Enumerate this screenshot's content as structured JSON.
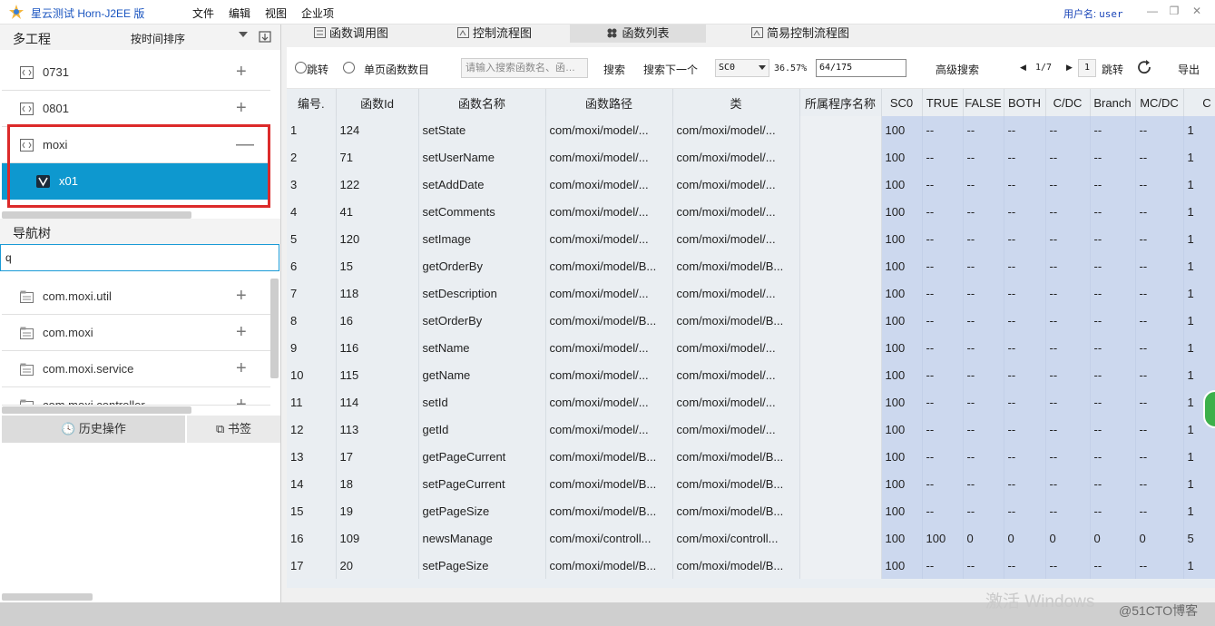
{
  "app": {
    "title": "星云测试 Horn-J2EE 版",
    "menus": [
      "文件",
      "编辑",
      "视图",
      "企业项"
    ],
    "user_label": "用户名:",
    "user_name": "user",
    "window_controls": [
      "minimize-icon",
      "restore-icon",
      "close-icon"
    ]
  },
  "projects": {
    "header": "多工程",
    "sort_label": "按时间排序",
    "items": [
      {
        "label": "0731",
        "expander": "+"
      },
      {
        "label": "0801",
        "expander": "+"
      },
      {
        "label": "moxi",
        "expander": "—"
      },
      {
        "label": "x01",
        "expander": ""
      }
    ]
  },
  "navtree": {
    "header": "导航树",
    "search_value": "q",
    "items": [
      {
        "label": "com.moxi.util",
        "expander": "+"
      },
      {
        "label": "com.moxi",
        "expander": "+"
      },
      {
        "label": "com.moxi.service",
        "expander": "+"
      },
      {
        "label": "com.moxi.controller",
        "expander": "+"
      }
    ]
  },
  "bottom_tabs": {
    "history": "历史操作",
    "bookmarks": "书签"
  },
  "tabs": [
    "函数调用图",
    "控制流程图",
    "函数列表",
    "简易控制流程图"
  ],
  "active_tab": "函数列表",
  "toolbar": {
    "jump_radio": "跳转",
    "single_page_radio": "单页函数数目",
    "search_placeholder": "请输入搜索函数名、函…",
    "search": "搜索",
    "search_next": "搜索下一个",
    "metric": "SC0",
    "percent": "36.57%",
    "ratio": "64/175",
    "advanced": "高级搜索",
    "page": "1/7",
    "page_input": "1",
    "goto": "跳转",
    "export": "导出"
  },
  "table": {
    "columns": [
      "编号.",
      "函数Id",
      "函数名称",
      "函数路径",
      "类",
      "所属程序名称",
      "SC0",
      "TRUE",
      "FALSE",
      "BOTH",
      "C/DC",
      "Branch",
      "MC/DC",
      "C"
    ],
    "rows": [
      [
        "1",
        "124",
        "setState",
        "com/moxi/model/...",
        "com/moxi/model/...",
        "",
        "100",
        "--",
        "--",
        "--",
        "--",
        "--",
        "--",
        "1"
      ],
      [
        "2",
        "71",
        "setUserName",
        "com/moxi/model/...",
        "com/moxi/model/...",
        "",
        "100",
        "--",
        "--",
        "--",
        "--",
        "--",
        "--",
        "1"
      ],
      [
        "3",
        "122",
        "setAddDate",
        "com/moxi/model/...",
        "com/moxi/model/...",
        "",
        "100",
        "--",
        "--",
        "--",
        "--",
        "--",
        "--",
        "1"
      ],
      [
        "4",
        "41",
        "setComments",
        "com/moxi/model/...",
        "com/moxi/model/...",
        "",
        "100",
        "--",
        "--",
        "--",
        "--",
        "--",
        "--",
        "1"
      ],
      [
        "5",
        "120",
        "setImage",
        "com/moxi/model/...",
        "com/moxi/model/...",
        "",
        "100",
        "--",
        "--",
        "--",
        "--",
        "--",
        "--",
        "1"
      ],
      [
        "6",
        "15",
        "getOrderBy",
        "com/moxi/model/B...",
        "com/moxi/model/B...",
        "",
        "100",
        "--",
        "--",
        "--",
        "--",
        "--",
        "--",
        "1"
      ],
      [
        "7",
        "118",
        "setDescription",
        "com/moxi/model/...",
        "com/moxi/model/...",
        "",
        "100",
        "--",
        "--",
        "--",
        "--",
        "--",
        "--",
        "1"
      ],
      [
        "8",
        "16",
        "setOrderBy",
        "com/moxi/model/B...",
        "com/moxi/model/B...",
        "",
        "100",
        "--",
        "--",
        "--",
        "--",
        "--",
        "--",
        "1"
      ],
      [
        "9",
        "116",
        "setName",
        "com/moxi/model/...",
        "com/moxi/model/...",
        "",
        "100",
        "--",
        "--",
        "--",
        "--",
        "--",
        "--",
        "1"
      ],
      [
        "10",
        "115",
        "getName",
        "com/moxi/model/...",
        "com/moxi/model/...",
        "",
        "100",
        "--",
        "--",
        "--",
        "--",
        "--",
        "--",
        "1"
      ],
      [
        "11",
        "114",
        "setId",
        "com/moxi/model/...",
        "com/moxi/model/...",
        "",
        "100",
        "--",
        "--",
        "--",
        "--",
        "--",
        "--",
        "1"
      ],
      [
        "12",
        "113",
        "getId",
        "com/moxi/model/...",
        "com/moxi/model/...",
        "",
        "100",
        "--",
        "--",
        "--",
        "--",
        "--",
        "--",
        "1"
      ],
      [
        "13",
        "17",
        "getPageCurrent",
        "com/moxi/model/B...",
        "com/moxi/model/B...",
        "",
        "100",
        "--",
        "--",
        "--",
        "--",
        "--",
        "--",
        "1"
      ],
      [
        "14",
        "18",
        "setPageCurrent",
        "com/moxi/model/B...",
        "com/moxi/model/B...",
        "",
        "100",
        "--",
        "--",
        "--",
        "--",
        "--",
        "--",
        "1"
      ],
      [
        "15",
        "19",
        "getPageSize",
        "com/moxi/model/B...",
        "com/moxi/model/B...",
        "",
        "100",
        "--",
        "--",
        "--",
        "--",
        "--",
        "--",
        "1"
      ],
      [
        "16",
        "109",
        "newsManage",
        "com/moxi/controll...",
        "com/moxi/controll...",
        "",
        "100",
        "100",
        "0",
        "0",
        "0",
        "0",
        "0",
        "5"
      ],
      [
        "17",
        "20",
        "setPageSize",
        "com/moxi/model/B...",
        "com/moxi/model/B...",
        "",
        "100",
        "--",
        "--",
        "--",
        "--",
        "--",
        "--",
        "1"
      ]
    ]
  },
  "watermark": "激活 Windows",
  "credit": "@51CTO博客",
  "colors": {
    "selected": "#0e98cf",
    "highlight_box": "#dc2a2a",
    "coverage_cells": "#ccd8ee",
    "title_text": "#1a55c0"
  }
}
